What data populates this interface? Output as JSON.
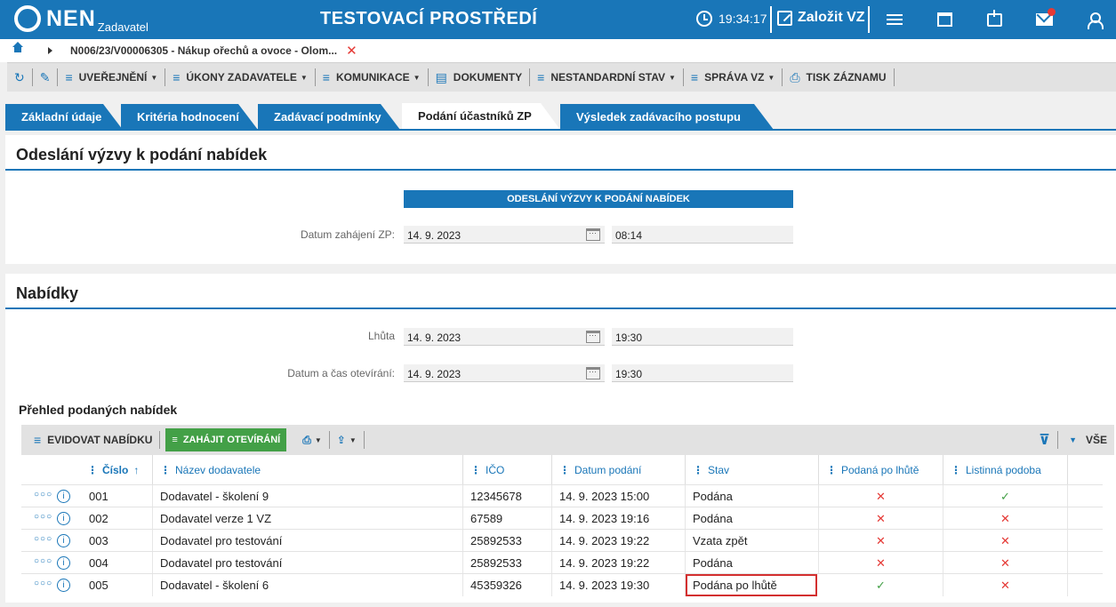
{
  "app": {
    "logo": "NEN",
    "logo_sub": "Zadavatel",
    "environment": "TESTOVACÍ PROSTŘEDÍ",
    "time": "19:34:17",
    "create_label": "Založit VZ"
  },
  "breadcrumb": {
    "text": "N006/23/V00006305 - Nákup ořechů a ovoce - Olom..."
  },
  "toolbar": {
    "uverejneni": "UVEŘEJNĚNÍ",
    "ukony": "ÚKONY ZADAVATELE",
    "komunikace": "KOMUNIKACE",
    "dokumenty": "DOKUMENTY",
    "nestandardni": "NESTANDARDNÍ STAV",
    "sprava": "SPRÁVA VZ",
    "tisk": "TISK ZÁZNAMU"
  },
  "tabs": [
    {
      "label": "Základní údaje"
    },
    {
      "label": "Kritéria hodnocení"
    },
    {
      "label": "Zadávací podmínky"
    },
    {
      "label": "Podání účastníků ZP"
    },
    {
      "label": "Výsledek zadávacího postupu"
    }
  ],
  "section1": {
    "title": "Odeslání výzvy k podání nabídek",
    "header": "ODESLÁNÍ VÝZVY K PODÁNÍ NABÍDEK",
    "date_label": "Datum zahájení ZP:",
    "date_value": "14. 9. 2023",
    "time_value": "08:14"
  },
  "section2": {
    "title": "Nabídky",
    "deadline_label": "Lhůta",
    "deadline_date": "14. 9. 2023",
    "deadline_time": "19:30",
    "opening_label": "Datum a čas otevírání:",
    "opening_date": "14. 9. 2023",
    "opening_time": "19:30"
  },
  "table": {
    "title": "Přehled podaných nabídek",
    "evidovat": "EVIDOVAT NABÍDKU",
    "zahajit": "ZAHÁJIT OTEVÍRÁNÍ",
    "filter_all": "VŠE",
    "columns": {
      "cislo": "Číslo",
      "nazev": "Název dodavatele",
      "ico": "IČO",
      "datum": "Datum podání",
      "stav": "Stav",
      "po_lhute": "Podaná po lhůtě",
      "listinna": "Listinná podoba"
    },
    "rows": [
      {
        "cislo": "001",
        "nazev": "Dodavatel - školení 9",
        "ico": "12345678",
        "datum": "14. 9. 2023 15:00",
        "stav": "Podána",
        "po_lhute": "✕",
        "listinna": "✓"
      },
      {
        "cislo": "002",
        "nazev": "Dodavatel verze 1 VZ",
        "ico": "67589",
        "datum": "14. 9. 2023 19:16",
        "stav": "Podána",
        "po_lhute": "✕",
        "listinna": "✕"
      },
      {
        "cislo": "003",
        "nazev": "Dodavatel pro testování",
        "ico": "25892533",
        "datum": "14. 9. 2023 19:22",
        "stav": "Vzata zpět",
        "po_lhute": "✕",
        "listinna": "✕"
      },
      {
        "cislo": "004",
        "nazev": "Dodavatel pro testování",
        "ico": "25892533",
        "datum": "14. 9. 2023 19:22",
        "stav": "Podána",
        "po_lhute": "✕",
        "listinna": "✕"
      },
      {
        "cislo": "005",
        "nazev": "Dodavatel - školení 6",
        "ico": "45359326",
        "datum": "14. 9. 2023 19:30",
        "stav": "Podána po lhůtě",
        "po_lhute": "✓",
        "listinna": "✕"
      }
    ]
  },
  "colors": {
    "brand": "#1976b8",
    "green": "#43a047",
    "red": "#e53935"
  }
}
